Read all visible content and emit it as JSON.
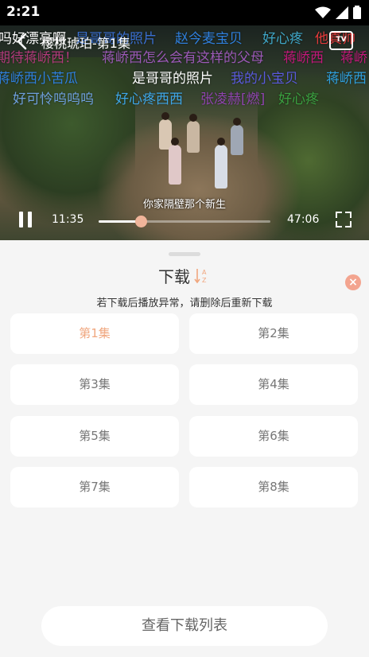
{
  "status_bar": {
    "time": "2:21"
  },
  "video": {
    "title": "樱桃琥珀-第1集",
    "subtitle": "你家隔壁那个新生",
    "current_time": "11:35",
    "total_time": "47:06",
    "progress": 0.246,
    "tv_label": "TV",
    "danmaku": [
      {
        "text": "吗好漂亮啊",
        "color": "#ffffff"
      },
      {
        "text": "是哥哥的照片",
        "color": "#3a6fd0"
      },
      {
        "text": "赵今麦宝贝",
        "color": "#2f7fdc"
      },
      {
        "text": "好心疼",
        "color": "#3fa7c8"
      },
      {
        "text": "他真帅",
        "color": "#e43a3a"
      },
      {
        "text": "期待蒋峤西！",
        "color": "#b13a7a"
      },
      {
        "text": "蒋峤西怎么会有这样的父母",
        "color": "#9b59b6"
      },
      {
        "text": "蒋峤西",
        "color": "#c2187a"
      },
      {
        "text": "蒋峤",
        "color": "#c2187a"
      },
      {
        "text": "蒋峤西小苦瓜",
        "color": "#2f7fdc"
      },
      {
        "text": "是哥哥的照片",
        "color": "#ffffff"
      },
      {
        "text": "我的小宝贝",
        "color": "#5a5adc"
      },
      {
        "text": "蒋峤西",
        "color": "#2f9fdc"
      },
      {
        "text": "好可怜呜呜呜",
        "color": "#6fa0dc"
      },
      {
        "text": "好心疼西西",
        "color": "#3fa7e8"
      },
      {
        "text": "张凌赫[燃]",
        "color": "#8e44ad"
      },
      {
        "text": "好心疼",
        "color": "#3aa040"
      }
    ]
  },
  "sheet": {
    "title": "下载",
    "sort_icon_label": "AZ",
    "close_icon": "×",
    "hint": "若下载后播放异常，请删除后重新下载",
    "episodes": [
      "第1集",
      "第2集",
      "第3集",
      "第4集",
      "第5集",
      "第6集",
      "第7集",
      "第8集"
    ],
    "active_episode": "第1集",
    "download_list_button": "查看下载列表"
  },
  "colors": {
    "accent": "#f0a77f",
    "close_bg": "#f3a48f"
  }
}
